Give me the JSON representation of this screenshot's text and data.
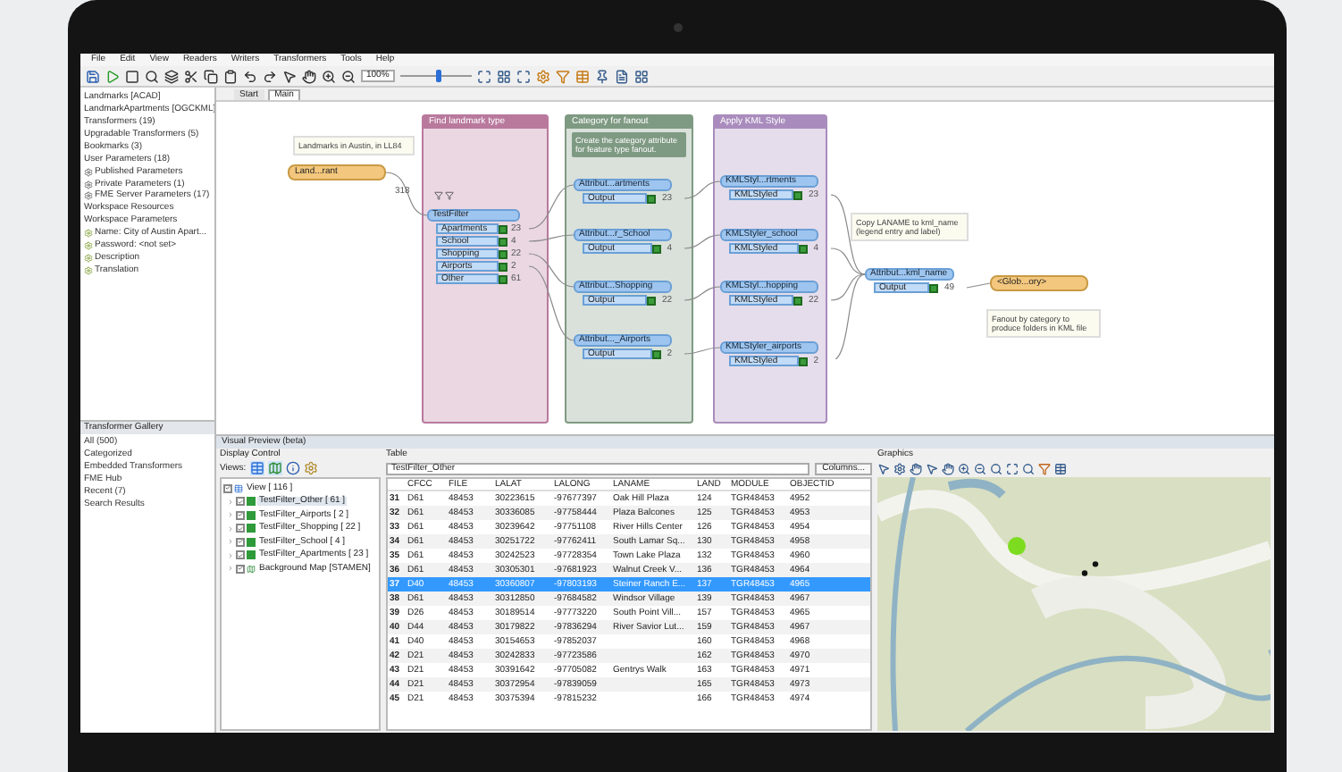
{
  "menu": [
    "File",
    "Edit",
    "View",
    "Readers",
    "Writers",
    "Transformers",
    "Tools",
    "Help"
  ],
  "toolbar": {
    "zoom": "100%",
    "zoom_slider": {
      "level": 0.55
    }
  },
  "navigator": {
    "items": [
      {
        "label": "Landmarks [ACAD]",
        "kind": "plain"
      },
      {
        "label": "LandmarkApartments [OGCKML]",
        "kind": "plain"
      },
      {
        "label": "Transformers (19)",
        "kind": "plain"
      },
      {
        "label": "Upgradable Transformers (5)",
        "kind": "plain"
      },
      {
        "label": "Bookmarks (3)",
        "kind": "plain"
      },
      {
        "label": "User Parameters (18)",
        "kind": "plain"
      },
      {
        "label": "Published Parameters",
        "kind": "param"
      },
      {
        "label": "Private Parameters (1)",
        "kind": "param"
      },
      {
        "label": "FME Server Parameters (17)",
        "kind": "param"
      },
      {
        "label": "Workspace Resources",
        "kind": "plain"
      },
      {
        "label": "Workspace Parameters",
        "kind": "plain"
      },
      {
        "label": "Name: City of Austin Apart...",
        "kind": "setting"
      },
      {
        "label": "Password: <not set>",
        "kind": "setting"
      },
      {
        "label": "Description",
        "kind": "setting"
      },
      {
        "label": "Translation",
        "kind": "setting"
      }
    ]
  },
  "gallery": {
    "title": "Transformer Gallery",
    "items": [
      "All (500)",
      "Categorized",
      "Embedded Transformers",
      "FME Hub",
      "Recent (7)",
      "Search Results"
    ]
  },
  "tabs": [
    {
      "label": "Start",
      "selected": false
    },
    {
      "label": "Main",
      "selected": true
    }
  ],
  "canvas": {
    "annotations": [
      "Landmarks in Austin, in LL84",
      "Copy LANAME to kml_name (legend entry and label)",
      "Fanout by category to produce folders in KML file"
    ],
    "reader": {
      "label": "Land...rant",
      "count": "318"
    },
    "bookmarks": [
      {
        "title": "Find landmark type",
        "color": "#b9799d"
      },
      {
        "title": "Category for fanout",
        "color": "#7f9a83",
        "note": "Create the category attribute for feature type fanout."
      },
      {
        "title": "Apply KML Style",
        "color": "#a98cbd"
      }
    ],
    "filter": {
      "title": "TestFilter",
      "ports": [
        {
          "label": "Apartments",
          "count": "23"
        },
        {
          "label": "School",
          "count": "4"
        },
        {
          "label": "Shopping",
          "count": "22"
        },
        {
          "label": "Airports",
          "count": "2"
        },
        {
          "label": "Other",
          "count": "61"
        }
      ]
    },
    "creators": [
      {
        "title": "Attribut...artments",
        "port": "Output",
        "count": "23"
      },
      {
        "title": "Attribut...r_School",
        "port": "Output",
        "count": "4"
      },
      {
        "title": "Attribut...Shopping",
        "port": "Output",
        "count": "22"
      },
      {
        "title": "Attribut..._Airports",
        "port": "Output",
        "count": "2"
      }
    ],
    "stylers": [
      {
        "title": "KMLStyl...rtments",
        "port": "KMLStyled",
        "count": "23"
      },
      {
        "title": "KMLStyler_school",
        "port": "KMLStyled",
        "count": "4"
      },
      {
        "title": "KMLStyl...hopping",
        "port": "KMLStyled",
        "count": "22"
      },
      {
        "title": "KMLStyler_airports",
        "port": "KMLStyled",
        "count": "2"
      }
    ],
    "final": {
      "title": "Attribut...kml_name",
      "port": "Output",
      "count": "49"
    },
    "writer": {
      "label": "<Glob...ory>"
    }
  },
  "preview": {
    "title": "Visual Preview (beta)",
    "display_control": "Display Control",
    "views_label": "Views:",
    "tree": [
      {
        "label": "View [ 116 ]",
        "checked": true,
        "kind": "view"
      },
      {
        "label": "TestFilter_Other [ 61 ]",
        "checked": true,
        "kind": "layer",
        "selected": true
      },
      {
        "label": "TestFilter_Airports [ 2 ]",
        "checked": true,
        "kind": "layer",
        "selected": false
      },
      {
        "label": "TestFilter_Shopping [ 22 ]",
        "checked": true,
        "kind": "layer",
        "selected": false
      },
      {
        "label": "TestFilter_School [ 4 ]",
        "checked": true,
        "kind": "layer",
        "selected": false
      },
      {
        "label": "TestFilter_Apartments [ 23 ]",
        "checked": true,
        "kind": "layer",
        "selected": false
      },
      {
        "label": "Background Map [STAMEN]",
        "checked": true,
        "kind": "map",
        "selected": false
      }
    ],
    "table_label": "Table",
    "table_select": "TestFilter_Other",
    "columns_button": "Columns...",
    "columns": [
      "CFCC",
      "FILE",
      "LALAT",
      "LALONG",
      "LANAME",
      "LAND",
      "MODULE",
      "OBJECTID"
    ],
    "rows": [
      {
        "num": "31",
        "cells": [
          "D61",
          "48453",
          "30223615",
          "-97677397",
          "Oak Hill Plaza",
          "124",
          "TGR48453",
          "4952"
        ],
        "selected": false
      },
      {
        "num": "32",
        "cells": [
          "D61",
          "48453",
          "30336085",
          "-97758444",
          "Plaza Balcones",
          "125",
          "TGR48453",
          "4953"
        ],
        "selected": false
      },
      {
        "num": "33",
        "cells": [
          "D61",
          "48453",
          "30239642",
          "-97751108",
          "River Hills Center",
          "126",
          "TGR48453",
          "4954"
        ],
        "selected": false
      },
      {
        "num": "34",
        "cells": [
          "D61",
          "48453",
          "30251722",
          "-97762411",
          "South Lamar Sq...",
          "130",
          "TGR48453",
          "4958"
        ],
        "selected": false
      },
      {
        "num": "35",
        "cells": [
          "D61",
          "48453",
          "30242523",
          "-97728354",
          "Town Lake Plaza",
          "132",
          "TGR48453",
          "4960"
        ],
        "selected": false
      },
      {
        "num": "36",
        "cells": [
          "D61",
          "48453",
          "30305301",
          "-97681923",
          "Walnut Creek V...",
          "136",
          "TGR48453",
          "4964"
        ],
        "selected": false
      },
      {
        "num": "37",
        "cells": [
          "D40",
          "48453",
          "30360807",
          "-97803193",
          "Steiner Ranch E...",
          "137",
          "TGR48453",
          "4965"
        ],
        "selected": true
      },
      {
        "num": "38",
        "cells": [
          "D61",
          "48453",
          "30312850",
          "-97684582",
          "Windsor Village",
          "139",
          "TGR48453",
          "4967"
        ],
        "selected": false
      },
      {
        "num": "39",
        "cells": [
          "D26",
          "48453",
          "30189514",
          "-97773220",
          "South Point Vill...",
          "157",
          "TGR48453",
          "4965"
        ],
        "selected": false
      },
      {
        "num": "40",
        "cells": [
          "D44",
          "48453",
          "30179822",
          "-97836294",
          "River Savior Lut...",
          "159",
          "TGR48453",
          "4967"
        ],
        "selected": false
      },
      {
        "num": "41",
        "cells": [
          "D40",
          "48453",
          "30154653",
          "-97852037",
          null,
          "160",
          "TGR48453",
          "4968"
        ],
        "selected": false
      },
      {
        "num": "42",
        "cells": [
          "D21",
          "48453",
          "30242833",
          "-97723586",
          null,
          "162",
          "TGR48453",
          "4970"
        ],
        "selected": false
      },
      {
        "num": "43",
        "cells": [
          "D21",
          "48453",
          "30391642",
          "-97705082",
          "Gentrys Walk",
          "163",
          "TGR48453",
          "4971"
        ],
        "selected": false
      },
      {
        "num": "44",
        "cells": [
          "D21",
          "48453",
          "30372954",
          "-97839059",
          null,
          "165",
          "TGR48453",
          "4973"
        ],
        "selected": false
      },
      {
        "num": "45",
        "cells": [
          "D21",
          "48453",
          "30375394",
          "-97815232",
          null,
          "166",
          "TGR48453",
          "4974"
        ],
        "selected": false
      }
    ],
    "graphics_label": "Graphics"
  }
}
